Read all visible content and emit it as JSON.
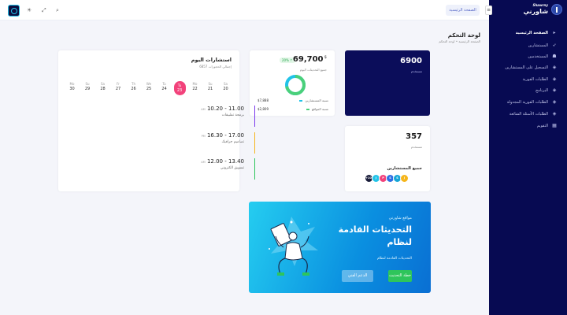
{
  "topbar": {
    "home_button": "الصفحة الرئيسية",
    "toggle_glyph": "≡",
    "icons": [
      "logo-icon",
      "sun-icon",
      "expand-icon",
      "search-icon"
    ]
  },
  "sidebar": {
    "brand_name": "شاورني",
    "brand_sub": "Shawrny",
    "items": [
      {
        "label": "الصفحة الرئيسية",
        "icon": "▸",
        "active": true
      },
      {
        "label": "المستشارين",
        "icon": "➶"
      },
      {
        "label": "المستخدمين",
        "icon": "☗"
      },
      {
        "label": "التسجيل على المستشارين",
        "icon": "◈"
      },
      {
        "label": "الطلبات الفورية",
        "icon": "◈"
      },
      {
        "label": "البرنامج",
        "icon": "◈"
      },
      {
        "label": "الطلبات الفورية المجدولة",
        "icon": "◈"
      },
      {
        "label": "الطلبات الأسئلة الشائعة",
        "icon": "◈"
      },
      {
        "label": "التقويم",
        "icon": "▦"
      }
    ]
  },
  "page": {
    "title": "لوحة التحكم",
    "breadcrumb_home": "الصفحة الرئيسية",
    "breadcrumb_sep": "•",
    "breadcrumb_current": "لوحة التحكم"
  },
  "stats": {
    "consultants_value": "6900",
    "consultants_label": "مستخدم",
    "users_value": "357",
    "users_label": "مستخدم",
    "all_consultants_label": "جميع المستشارين",
    "avatars": [
      "+10k",
      "J",
      "P",
      "S",
      "S",
      "J"
    ],
    "avatar_colors": [
      "#1a1d3a",
      "#21c3e8",
      "#f2427b",
      "#2d6ee3",
      "#16a6d6",
      "#f5b51b"
    ]
  },
  "revenue": {
    "currency": "$",
    "value": "69,700",
    "badge": "20% ↑",
    "label": "جميع التحديثات اليوم",
    "row1_label": "نسبة المستشارين",
    "row1_value": "$7,888",
    "row2_label": "نسبة المواقع",
    "row2_value": "$2,809",
    "donut_fraction": 0.72
  },
  "appointments": {
    "title": "استشارات اليوم",
    "subtitle": "إجمالي الحجوزات 6857",
    "days": [
      {
        "d": "Mo",
        "n": "30"
      },
      {
        "d": "Su",
        "n": "29"
      },
      {
        "d": "Sa",
        "n": "28"
      },
      {
        "d": "Fr",
        "n": "27"
      },
      {
        "d": "Th",
        "n": "26"
      },
      {
        "d": "We",
        "n": "25"
      },
      {
        "d": "Tu",
        "n": "24"
      },
      {
        "d": "Tu",
        "n": "23",
        "selected": true
      },
      {
        "d": "Mo",
        "n": "22"
      },
      {
        "d": "Su",
        "n": "21"
      },
      {
        "d": "Sa",
        "n": "20"
      }
    ],
    "items": [
      {
        "time": "10.20 - 11.00",
        "ampm": "AM",
        "title": "برمجة تطبيقات",
        "color": "#7c3aed"
      },
      {
        "time": "16.30 - 17.00",
        "ampm": "PM",
        "title": "تصاميم جرافيك",
        "color": "#f5b51b"
      },
      {
        "time": "12.00 - 13.40",
        "ampm": "AM",
        "title": "تسويق الكتروني",
        "color": "#2ec55b"
      }
    ]
  },
  "promo": {
    "kicker": "مواقع شاورني",
    "title_line1": "التحديثات القادمة",
    "title_line2": "لنظام",
    "subtitle": "التحديثات القادمة لنظام",
    "btn_primary": "خطة التحديث",
    "btn_secondary": "الدعم الفني"
  },
  "colors": {
    "sidebar_bg": "#070a52",
    "accent_pink": "#f2427b",
    "accent_green": "#2ec55b",
    "donut_green": "#4ad07a",
    "donut_blue": "#21c3e8"
  }
}
